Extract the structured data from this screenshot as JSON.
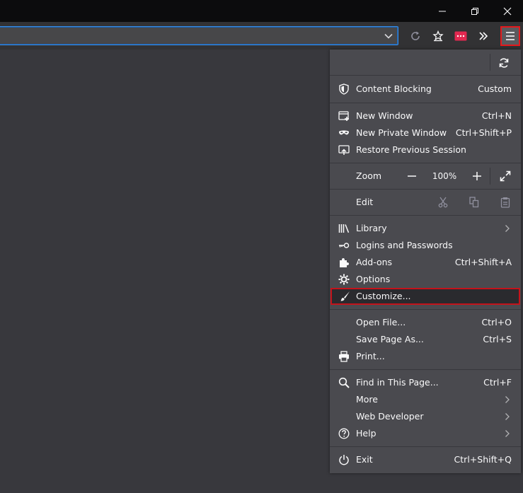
{
  "window": {
    "minimize_icon": "minimize-icon",
    "restore_icon": "restore-icon",
    "close_icon": "close-icon"
  },
  "toolbar": {
    "icons": [
      "reload-icon",
      "bookmark-star-icon",
      "extension-icon",
      "overflow-chevrons-icon",
      "hamburger-menu-icon"
    ],
    "extension_color": "#e22850"
  },
  "menu": {
    "content_blocking": {
      "label": "Content Blocking",
      "value": "Custom"
    },
    "new_window": {
      "label": "New Window",
      "shortcut": "Ctrl+N"
    },
    "new_private_window": {
      "label": "New Private Window",
      "shortcut": "Ctrl+Shift+P"
    },
    "restore_session": {
      "label": "Restore Previous Session"
    },
    "zoom": {
      "label": "Zoom",
      "value": "100%"
    },
    "edit": {
      "label": "Edit"
    },
    "library": {
      "label": "Library"
    },
    "logins": {
      "label": "Logins and Passwords"
    },
    "addons": {
      "label": "Add-ons",
      "shortcut": "Ctrl+Shift+A"
    },
    "options": {
      "label": "Options"
    },
    "customize": {
      "label": "Customize..."
    },
    "open_file": {
      "label": "Open File...",
      "shortcut": "Ctrl+O"
    },
    "save_page": {
      "label": "Save Page As...",
      "shortcut": "Ctrl+S"
    },
    "print": {
      "label": "Print..."
    },
    "find": {
      "label": "Find in This Page...",
      "shortcut": "Ctrl+F"
    },
    "more": {
      "label": "More"
    },
    "web_developer": {
      "label": "Web Developer"
    },
    "help": {
      "label": "Help"
    },
    "exit": {
      "label": "Exit",
      "shortcut": "Ctrl+Shift+Q"
    }
  },
  "colors": {
    "highlight_border": "#c4131b",
    "urlbar_focus": "#3a8ee6"
  }
}
